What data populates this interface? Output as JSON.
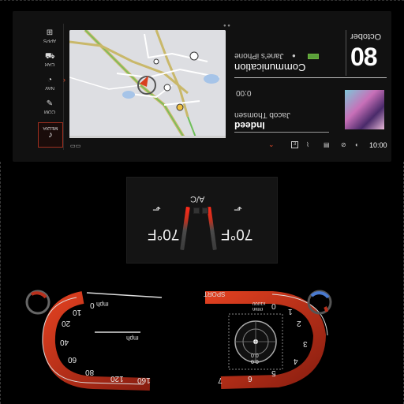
{
  "sidebar": {
    "items": [
      {
        "label": "APPS",
        "icon": "grid-icon"
      },
      {
        "label": "CAR",
        "icon": "car-icon"
      },
      {
        "label": "NAV",
        "icon": "compass-icon"
      },
      {
        "label": "COM",
        "icon": "message-icon"
      },
      {
        "label": "MEDIA",
        "icon": "music-note-icon"
      }
    ],
    "active": "MEDIA"
  },
  "map": {
    "label": "navigation map"
  },
  "date": {
    "month": "October",
    "day": "08"
  },
  "communication": {
    "title": "Communication",
    "device": "Jane's iPhone",
    "battery_color": "#5aa03a"
  },
  "media": {
    "elapsed": "0:00",
    "artist": "Jacob Thomsen",
    "title": "Indeed"
  },
  "status_bar": {
    "time": "10:00",
    "box_value": "3"
  },
  "climate": {
    "ac_label": "A/C",
    "temp_left": "70°F",
    "temp_right": "70°F",
    "accent": "#ff2a1a"
  },
  "speedometer": {
    "unit": "mph",
    "ticks": [
      "0",
      "10",
      "20",
      "40",
      "60",
      "80",
      "120",
      "160"
    ],
    "readout_unit": "mph"
  },
  "tachometer": {
    "mode": "SPORT",
    "unit_label": "x1000",
    "unit_label2": "r/min",
    "ticks": [
      "0",
      "1",
      "2",
      "3",
      "4",
      "5",
      "6",
      "7"
    ],
    "readout_a": "0.0",
    "readout_b": "0.0"
  },
  "colors": {
    "accent": "#e04a2a",
    "gauge_red": "#b8301c"
  }
}
